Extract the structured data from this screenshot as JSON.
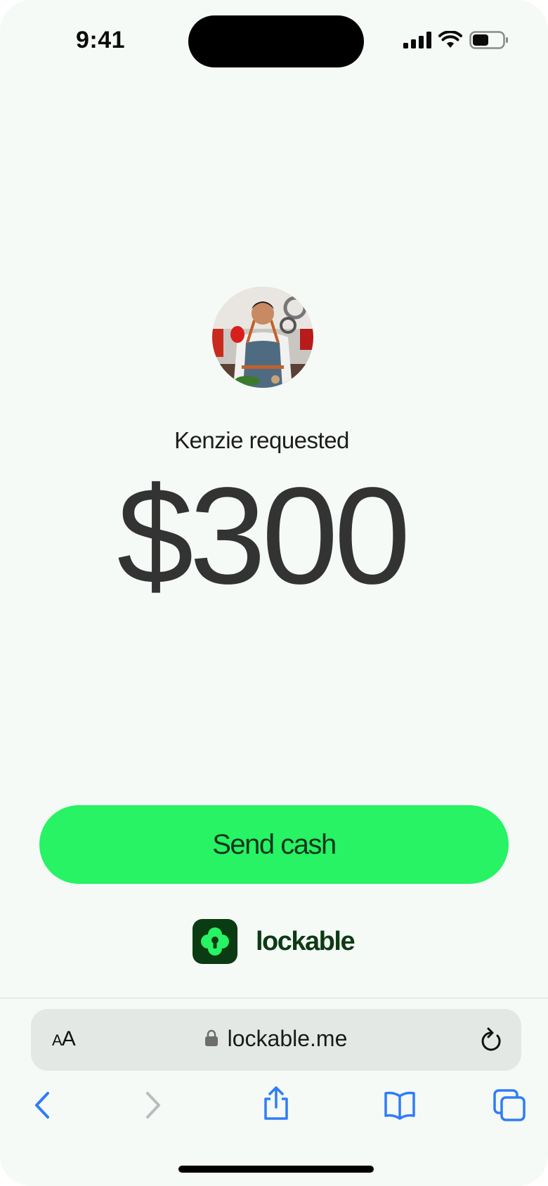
{
  "status_bar": {
    "time": "9:41",
    "icons": [
      "signal-icon",
      "wifi-icon",
      "battery-icon"
    ]
  },
  "request": {
    "requester_text": "Kenzie requested",
    "amount": "$300",
    "avatar_alt": "Kenzie avatar"
  },
  "actions": {
    "send_label": "Send cash"
  },
  "brand": {
    "name": "lockable",
    "logo_icon": "lockable-logo-icon"
  },
  "browser": {
    "text_size_label_small": "A",
    "text_size_label_large": "A",
    "url": "lockable.me",
    "toolbar": [
      "back-icon",
      "forward-icon",
      "share-icon",
      "bookmarks-icon",
      "tabs-icon"
    ]
  },
  "colors": {
    "background": "#f5faf6",
    "accent": "#27f364",
    "brand_dark": "#0b3b12",
    "safari_blue": "#2f7cf6"
  }
}
